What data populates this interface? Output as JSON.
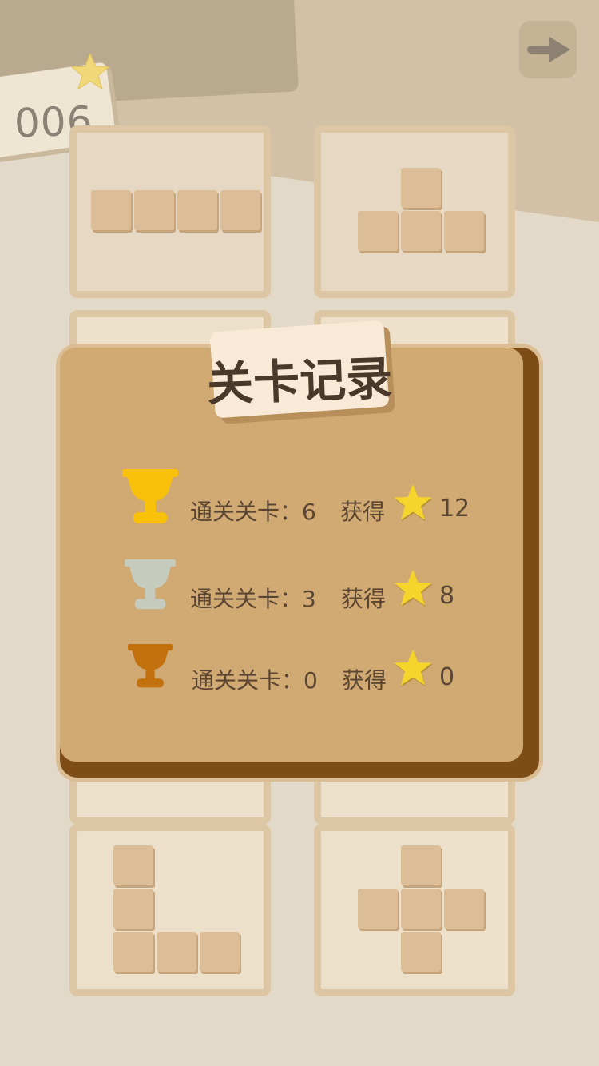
{
  "header": {
    "level_number": "006",
    "star_icon": "star-icon",
    "next_icon": "arrow-right-icon"
  },
  "dialog": {
    "title": "关卡记录",
    "rows": [
      {
        "trophy": "gold-trophy-icon",
        "trophy_color": "#f9c10a",
        "cleared_label": "通关关卡：6",
        "gain_label": "获得",
        "stars": "12"
      },
      {
        "trophy": "silver-trophy-icon",
        "trophy_color": "#c5cbbd",
        "cleared_label": "通关关卡：3",
        "gain_label": "获得",
        "stars": "8"
      },
      {
        "trophy": "bronze-trophy-icon",
        "trophy_color": "#c2710e",
        "cleared_label": "通关关卡：0",
        "gain_label": "获得",
        "stars": "0"
      }
    ]
  },
  "colors": {
    "background": "#e3d9c8",
    "dialog": "#d1a973",
    "dialog_shadow": "#7e4c16",
    "star": "#f5d52c"
  }
}
